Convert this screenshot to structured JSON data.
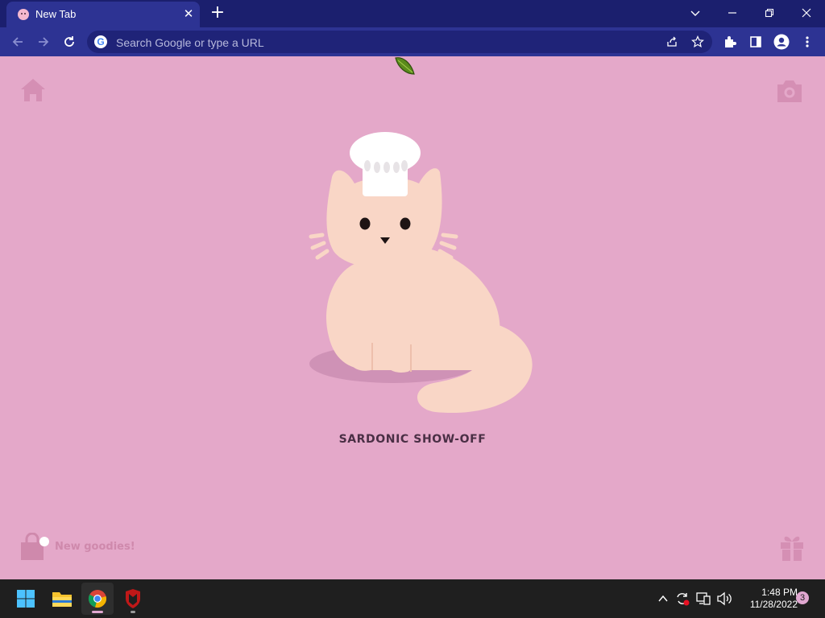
{
  "browser": {
    "tab": {
      "title": "New Tab",
      "close_glyph": "✕"
    },
    "new_tab_glyph": "+",
    "omnibox": {
      "placeholder": "Search Google or type a URL",
      "google_letter": "G"
    }
  },
  "page": {
    "background_color": "#e4a8c9",
    "cat_name": "SARDONIC SHOW-OFF",
    "goodies_label": "New goodies!"
  },
  "taskbar": {
    "time": "1:48 PM",
    "date": "11/28/2022",
    "notification_count": "3"
  },
  "colors": {
    "tabstrip": "#1b1f6e",
    "toolbar": "#2d3393",
    "cat_body": "#f9d6c6",
    "taskbar": "#1f1f1f"
  }
}
